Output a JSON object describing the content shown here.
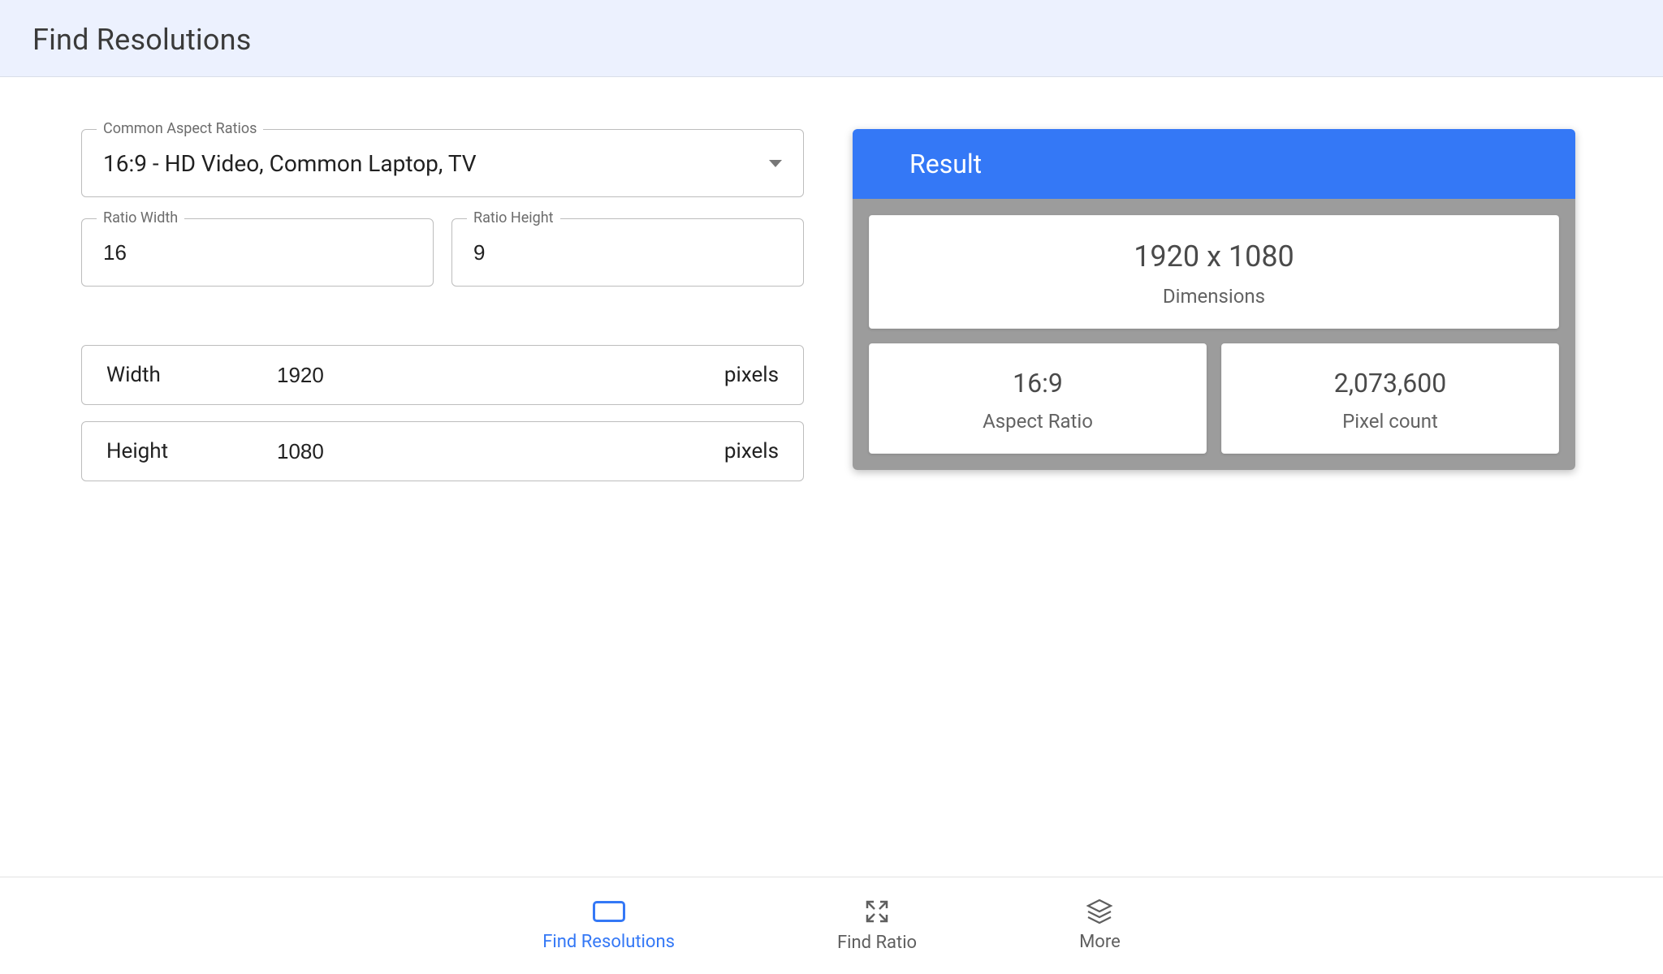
{
  "header": {
    "title": "Find Resolutions"
  },
  "aspect_select": {
    "label": "Common Aspect Ratios",
    "value": "16:9 - HD Video, Common Laptop, TV"
  },
  "ratio_width": {
    "label": "Ratio Width",
    "value": "16"
  },
  "ratio_height": {
    "label": "Ratio Height",
    "value": "9"
  },
  "width_field": {
    "label": "Width",
    "value": "1920",
    "unit": "pixels"
  },
  "height_field": {
    "label": "Height",
    "value": "1080",
    "unit": "pixels"
  },
  "result": {
    "title": "Result",
    "dimensions": {
      "value": "1920 x 1080",
      "label": "Dimensions"
    },
    "aspect_ratio": {
      "value": "16:9",
      "label": "Aspect Ratio"
    },
    "pixel_count": {
      "value": "2,073,600",
      "label": "Pixel count"
    }
  },
  "nav": {
    "find_resolutions": "Find Resolutions",
    "find_ratio": "Find Ratio",
    "more": "More"
  }
}
